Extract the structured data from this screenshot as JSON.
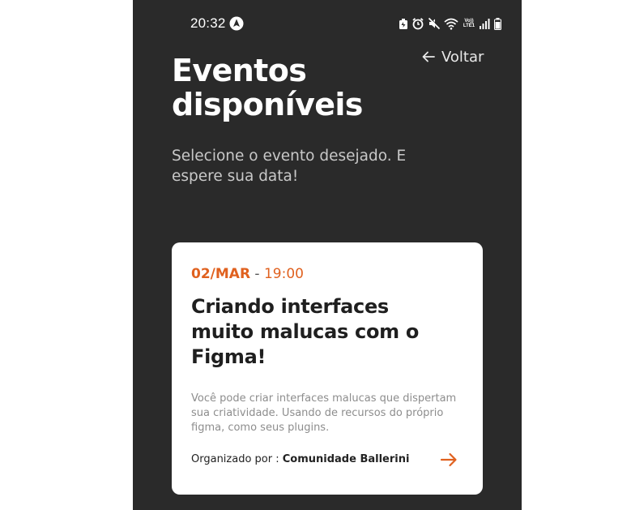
{
  "status_bar": {
    "time": "20:32",
    "network_label": "Vo)) LTE1"
  },
  "header": {
    "back_label": "Voltar",
    "title": "Eventos disponíveis",
    "subtitle": "Selecione o evento desejado. E espere sua data!"
  },
  "event": {
    "date": "02/MAR",
    "separator": " - ",
    "time": "19:00",
    "title": "Criando interfaces muito malucas com o Figma!",
    "description": "Você pode criar interfaces malucas que dispertam sua criatividade. Usando de recursos do próprio figma, como seus plugins.",
    "organizer_prefix": "Organizado por : ",
    "organizer_name": "Comunidade Ballerini"
  },
  "colors": {
    "background": "#2a2a2a",
    "accent": "#e0611f",
    "card": "#ffffff"
  },
  "icons": {
    "status_nav": "navigation-icon",
    "back": "arrow-left-icon",
    "card_action": "arrow-right-icon"
  }
}
